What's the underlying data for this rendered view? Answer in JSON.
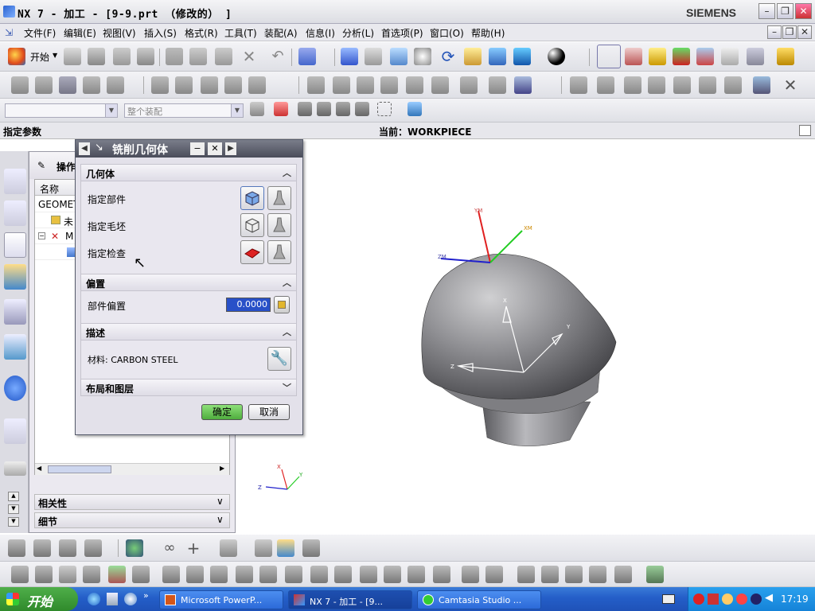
{
  "window": {
    "title": "NX 7 - 加工 - [9-9.prt （修改的） ]",
    "brand": "SIEMENS"
  },
  "menu": [
    "文件(F)",
    "编辑(E)",
    "视图(V)",
    "插入(S)",
    "格式(R)",
    "工具(T)",
    "装配(A)",
    "信息(I)",
    "分析(L)",
    "首选项(P)",
    "窗口(O)",
    "帮助(H)"
  ],
  "toolbar": {
    "start_label": "开始",
    "assembly_filter": "整个装配"
  },
  "status": {
    "prompt": "指定参数",
    "current": "当前：WORKPIECE"
  },
  "navigator": {
    "header": "操作",
    "column_name": "名称",
    "rows": [
      "GEOMET",
      "未",
      "M"
    ],
    "sections": [
      "相关性",
      "细节"
    ]
  },
  "dialog": {
    "title": "铣削几何体",
    "sections": {
      "geometry": {
        "title": "几何体",
        "rows": [
          "指定部件",
          "指定毛坯",
          "指定检查"
        ]
      },
      "offset": {
        "title": "偏置",
        "label": "部件偏置",
        "value": "0.0000"
      },
      "description": {
        "title": "描述",
        "material": "材料: CARBON STEEL"
      },
      "layout": {
        "title": "布局和图层"
      }
    },
    "ok": "确定",
    "cancel": "取消"
  },
  "viewport": {
    "csys_labels": [
      "YM",
      "XM",
      "ZM"
    ],
    "wcs_labels": [
      "X",
      "Y",
      "Z"
    ],
    "triad_labels": [
      "X",
      "Y",
      "Z"
    ]
  },
  "taskbar": {
    "start": "开始",
    "tasks": [
      "Microsoft PowerP...",
      "NX 7 - 加工 - [9...",
      "Camtasia Studio ..."
    ],
    "clock": "17:19"
  },
  "colors": {
    "titlebar_text": "#000000",
    "dialog_title_bg": "#4a4d5a",
    "taskbar": "#245ec8",
    "start_green": "#3f9a3a",
    "ok_button": "#5fbf4a",
    "model_gray": "#8a8a8e",
    "csys_red": "#e02020",
    "csys_green": "#22cc22",
    "csys_blue": "#2020cc"
  }
}
